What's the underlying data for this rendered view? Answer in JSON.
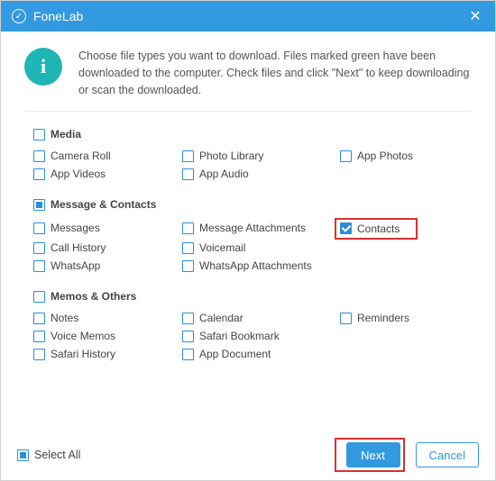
{
  "title": "FoneLab",
  "close_glyph": "✕",
  "info_glyph": "i",
  "header_text": "Choose file types you want to download. Files marked green have been downloaded to the computer. Check files and click \"Next\" to keep downloading or scan the downloaded.",
  "sections": {
    "media": {
      "label": "Media",
      "items": {
        "camera_roll": "Camera Roll",
        "photo_library": "Photo Library",
        "app_photos": "App Photos",
        "app_videos": "App Videos",
        "app_audio": "App Audio"
      }
    },
    "msgcontacts": {
      "label": "Message & Contacts",
      "items": {
        "messages": "Messages",
        "msg_attach": "Message Attachments",
        "contacts": "Contacts",
        "call_history": "Call History",
        "voicemail": "Voicemail",
        "whatsapp": "WhatsApp",
        "wa_attach": "WhatsApp Attachments"
      }
    },
    "memos": {
      "label": "Memos & Others",
      "items": {
        "notes": "Notes",
        "calendar": "Calendar",
        "reminders": "Reminders",
        "voice_memos": "Voice Memos",
        "safari_bookmark": "Safari Bookmark",
        "safari_history": "Safari History",
        "app_document": "App Document"
      }
    }
  },
  "footer": {
    "select_all": "Select All",
    "next": "Next",
    "cancel": "Cancel"
  }
}
